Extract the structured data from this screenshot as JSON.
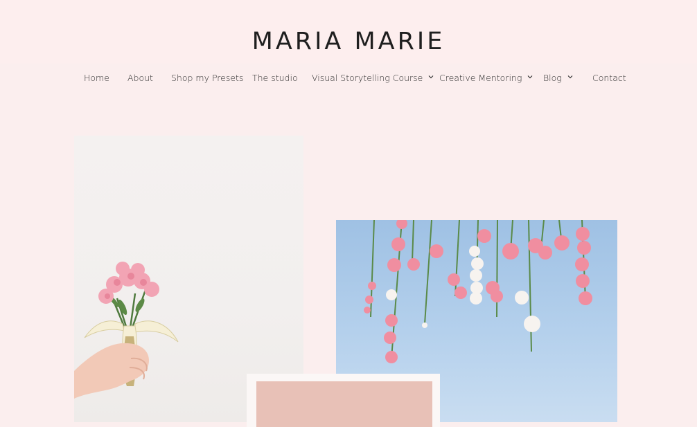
{
  "brand": {
    "logo_text": "MARIA MARIE"
  },
  "nav": {
    "items": [
      {
        "label": "Home",
        "has_dropdown": false
      },
      {
        "label": "About",
        "has_dropdown": false
      },
      {
        "label": "Shop my Presets",
        "has_dropdown": false
      },
      {
        "label": "The studio",
        "has_dropdown": false
      },
      {
        "label": "Visual Storytelling Course",
        "has_dropdown": true
      },
      {
        "label": "Creative Mentoring",
        "has_dropdown": true
      },
      {
        "label": "Blog",
        "has_dropdown": true
      },
      {
        "label": "Contact",
        "has_dropdown": false
      }
    ]
  },
  "colors": {
    "page_background": "#fbeeee",
    "header_background": "#fdeeee",
    "text": "#2a2a2a",
    "sky_blue": "#a9c7e8",
    "card_pink": "#e8c1b7"
  },
  "images": {
    "left": "hand-holding-banana-with-pink-flowers",
    "right": "pink-carnations-hanging-against-blue-sky",
    "card": "pink-card"
  }
}
